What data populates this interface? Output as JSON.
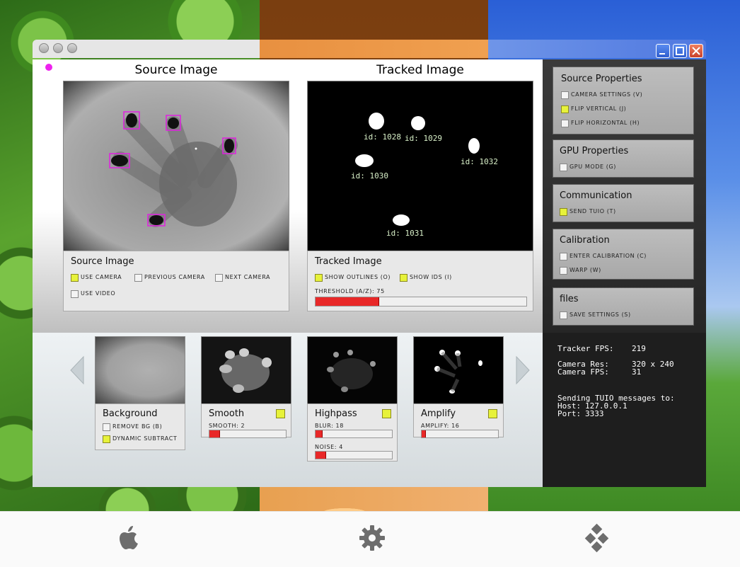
{
  "source_panel": {
    "title": "Source Image",
    "box_title": "Source Image",
    "use_camera": "use camera",
    "previous_camera": "previous camera",
    "next_camera": "next camera",
    "use_video": "use video"
  },
  "tracked_panel": {
    "title": "Tracked Image",
    "box_title": "Tracked Image",
    "show_outlines": "show outlines (o)",
    "show_ids": "show ids (i)",
    "threshold_label": "threshold (a/z): 75",
    "threshold_value": 0.3,
    "blob_ids": [
      "id: 1028",
      "id: 1029",
      "id: 1032",
      "id: 1030",
      "id: 1031"
    ]
  },
  "filters": {
    "background": {
      "title": "Background",
      "remove_bg": "remove bg (b)",
      "dynamic_subtract": "dynamic subtract"
    },
    "smooth": {
      "title": "Smooth",
      "slider_label": "smooth: 2",
      "value": 0.13
    },
    "highpass": {
      "title": "Highpass",
      "blur_label": "blur: 18",
      "blur_value": 0.08,
      "noise_label": "noise: 4",
      "noise_value": 0.13
    },
    "amplify": {
      "title": "Amplify",
      "slider_label": "amplify: 16",
      "value": 0.05
    }
  },
  "sidebar": {
    "source_properties": {
      "title": "Source Properties",
      "camera_settings": "camera settings (v)",
      "flip_vertical": "flip vertical (j)",
      "flip_horizontal": "flip horizontal (h)"
    },
    "gpu_properties": {
      "title": "GPU Properties",
      "gpu_mode": "gpu mode (g)"
    },
    "communication": {
      "title": "Communication",
      "send_tuio": "send tuio (t)"
    },
    "calibration": {
      "title": "Calibration",
      "enter_calibration": "enter calibration (c)",
      "warp": "warp (w)"
    },
    "files": {
      "title": "files",
      "save_settings": "save settings (s)"
    },
    "stats": {
      "tracker_fps_label": "Tracker FPS:",
      "tracker_fps": "219",
      "camera_res_label": "Camera Res:",
      "camera_res": "320 x 240",
      "camera_fps_label": "Camera FPS:",
      "camera_fps": "31",
      "sending_label": "Sending TUIO messages to:",
      "host_label": "Host:",
      "host": "127.0.0.1",
      "port_label": "Port:",
      "port": "3333"
    }
  },
  "colors": {
    "checkbox_on": "#e7f23a",
    "slider_fill": "#e82828",
    "indicator": "#ee22ee"
  },
  "footer": {
    "icons": [
      "apple-icon",
      "gear-icon",
      "windows-icon"
    ]
  }
}
